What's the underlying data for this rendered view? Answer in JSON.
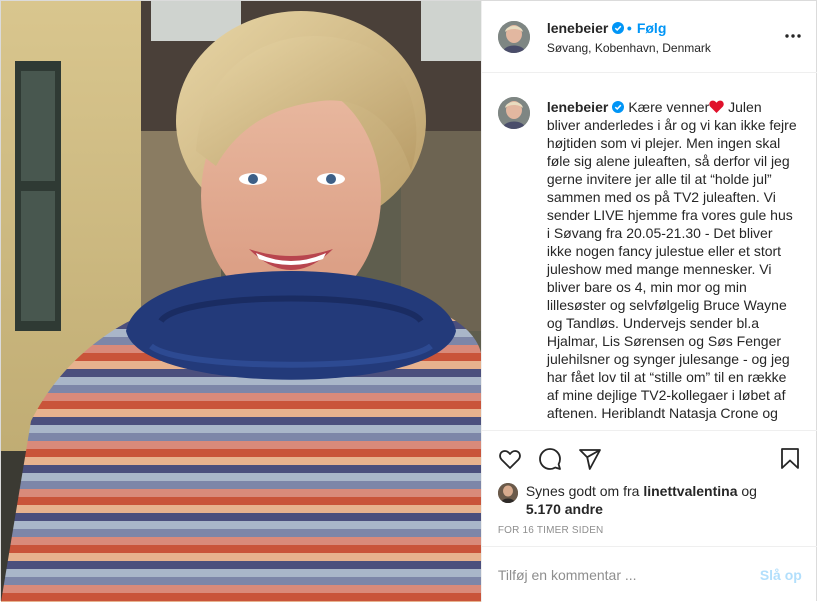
{
  "post": {
    "username": "lenebeier",
    "verified": true,
    "separator": "•",
    "follow_label": "Følg",
    "location": "Søvang, Kobenhavn, Denmark",
    "more_icon": "more-options-icon"
  },
  "caption": {
    "username": "lenebeier",
    "text_before_heart": "Kære venner",
    "heart_icon": "red-heart-emoji",
    "text_after_heart": " Julen bliver anderledes i år og vi kan ikke fejre højtiden som vi plejer. Men ingen skal føle sig alene juleaften, så derfor vil jeg gerne invitere jer alle til at “holde jul” sammen med os på TV2 juleaften. Vi sender LIVE hjemme fra vores gule hus i Søvang fra 20.05-21.30 - Det bliver ikke nogen fancy julestue eller et stort juleshow med mange mennesker. Vi bliver bare os 4, min mor og min lillesøster og selvfølgelig Bruce Wayne og Tandløs. Undervejs sender bl.a Hjalmar, Lis Sørensen og Søs Fenger julehilsner og synger julesange - og jeg har fået lov til at “stille om” til en række af mine dejlige TV2-kollegaer i løbet af aftenen. Heriblandt Natasja Crone og"
  },
  "actions": {
    "like_icon": "heart-outline-icon",
    "comment_icon": "comment-icon",
    "share_icon": "paper-plane-icon",
    "save_icon": "bookmark-icon"
  },
  "likes": {
    "prefix": "Synes godt om fra ",
    "liker": "linettvalentina",
    "conjunction": " og",
    "others": "5.170 andre"
  },
  "timestamp": "FOR 16 TIMER SIDEN",
  "comment": {
    "placeholder": "Tilføj en kommentar ...",
    "post_label": "Slå op",
    "post_color": "#b2dffc"
  },
  "colors": {
    "accent": "#0095f6",
    "text": "#262626",
    "muted": "#8e8e8e",
    "border": "#efefef"
  }
}
